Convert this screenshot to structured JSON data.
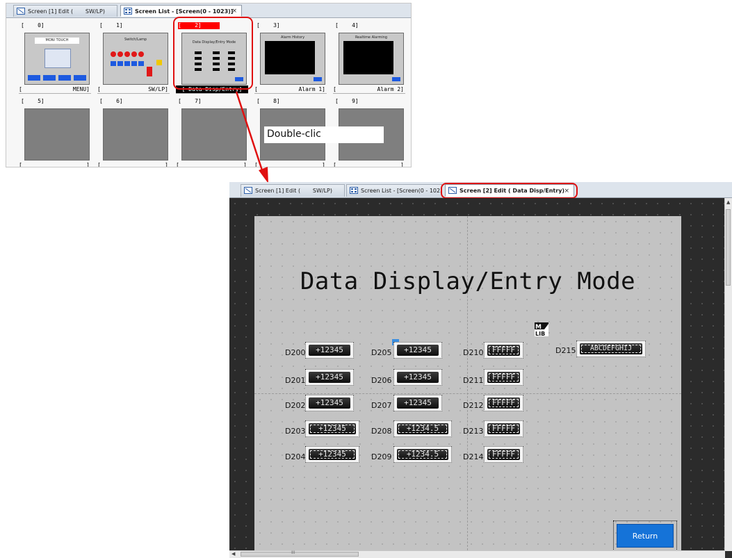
{
  "list_window": {
    "tabs": [
      {
        "label": "Screen [1] Edit (       SW/LP)"
      },
      {
        "label": "Screen List - [Screen(0 - 1023)]"
      }
    ],
    "close_glyph": "×",
    "cells": [
      {
        "index": "[    0]",
        "name": "MENU]",
        "name_prefix": "[",
        "title": "MONI TOUCH"
      },
      {
        "index": "[    1]",
        "name": "SW/LP]",
        "name_prefix": "[",
        "title": "Switch/Lamp"
      },
      {
        "index": "[    2]",
        "name": "[ Data Disp/Entry]",
        "name_prefix": "",
        "title": "Data Display/Entry Mode"
      },
      {
        "index": "[    3]",
        "name": "Alarm 1]",
        "name_prefix": "[",
        "title": "Alarm History"
      },
      {
        "index": "[    4]",
        "name": "Alarm 2]",
        "name_prefix": "[",
        "title": "Realtime Alarming"
      },
      {
        "index": "[    5]",
        "name": "]",
        "name_prefix": "[",
        "title": ""
      },
      {
        "index": "[    6]",
        "name": "]",
        "name_prefix": "[",
        "title": ""
      },
      {
        "index": "[    7]",
        "name": "]",
        "name_prefix": "[",
        "title": ""
      },
      {
        "index": "[    8]",
        "name": "]",
        "name_prefix": "[",
        "title": ""
      },
      {
        "index": "[    9]",
        "name": "]",
        "name_prefix": "[",
        "title": ""
      }
    ]
  },
  "annotation": {
    "text": "Double-clic"
  },
  "edit_window": {
    "tabs": [
      {
        "label": "Screen [1] Edit (       SW/LP)"
      },
      {
        "label": "Screen List - [Screen(0 - 1023)"
      },
      {
        "label": "Screen [2] Edit ( Data Disp/Entry)"
      }
    ],
    "close_glyph": "×",
    "screen_title": "Data Display/Entry Mode",
    "mlib_top": "M",
    "mlib_bottom": "LIB",
    "items": [
      {
        "label": "D200",
        "value": "+12345"
      },
      {
        "label": "D201",
        "value": "+12345"
      },
      {
        "label": "D202",
        "value": "+12345"
      },
      {
        "label": "D203",
        "value": "+12345"
      },
      {
        "label": "D204",
        "value": "+12345"
      },
      {
        "label": "D205",
        "value": "+12345"
      },
      {
        "label": "D206",
        "value": "+12345"
      },
      {
        "label": "D207",
        "value": "+12345"
      },
      {
        "label": "D208",
        "value": "+1234.5"
      },
      {
        "label": "D209",
        "value": "+1234.5"
      },
      {
        "label": "D210",
        "value": "FFFFF"
      },
      {
        "label": "D211",
        "value": "FFFFF"
      },
      {
        "label": "D212",
        "value": "FFFFF"
      },
      {
        "label": "D213",
        "value": "FFFFF"
      },
      {
        "label": "D214",
        "value": "FFFFF"
      },
      {
        "label": "D215",
        "value": "ABCDEFGHIJ"
      }
    ],
    "return_label": "Return",
    "hscroll_glyph": "III",
    "colors": {
      "highlight": "#e01010",
      "button": "#1573d8"
    }
  }
}
